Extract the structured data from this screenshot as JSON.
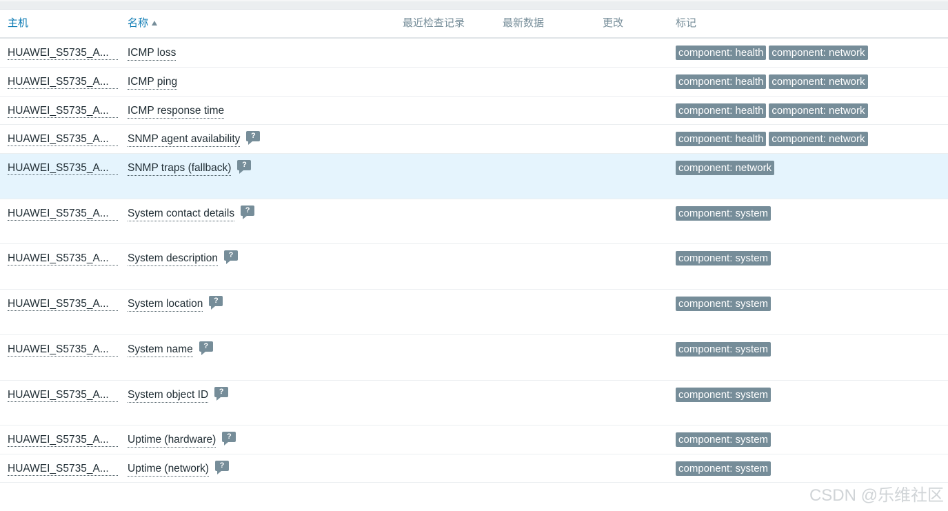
{
  "table": {
    "columns": {
      "host": "主机",
      "name": "名称",
      "last_check": "最近检查记录",
      "latest_data": "最新数据",
      "change": "更改",
      "tags": "标记"
    },
    "rows": [
      {
        "host": "HUAWEI_S5735_A...",
        "name": "ICMP loss",
        "help": "",
        "tags": [
          "component: health",
          "component: network"
        ]
      },
      {
        "host": "HUAWEI_S5735_A...",
        "name": "ICMP ping",
        "help": "",
        "tags": [
          "component: health",
          "component: network"
        ]
      },
      {
        "host": "HUAWEI_S5735_A...",
        "name": "ICMP response time",
        "help": "",
        "tags": [
          "component: health",
          "component: network"
        ]
      },
      {
        "host": "HUAWEI_S5735_A...",
        "name": "SNMP agent availability",
        "help": "?",
        "tags": [
          "component: health",
          "component: network"
        ]
      },
      {
        "host": "HUAWEI_S5735_A...",
        "name": "SNMP traps (fallback)",
        "help": "?",
        "tags": [
          "component: network"
        ]
      },
      {
        "host": "HUAWEI_S5735_A...",
        "name": "System contact details",
        "help": "?",
        "tags": [
          "component: system"
        ]
      },
      {
        "host": "HUAWEI_S5735_A...",
        "name": "System description",
        "help": "?",
        "tags": [
          "component: system"
        ]
      },
      {
        "host": "HUAWEI_S5735_A...",
        "name": "System location",
        "help": "?",
        "tags": [
          "component: system"
        ]
      },
      {
        "host": "HUAWEI_S5735_A...",
        "name": "System name",
        "help": "?",
        "tags": [
          "component: system"
        ]
      },
      {
        "host": "HUAWEI_S5735_A...",
        "name": "System object ID",
        "help": "?",
        "tags": [
          "component: system"
        ]
      },
      {
        "host": "HUAWEI_S5735_A...",
        "name": "Uptime (hardware)",
        "help": "?",
        "tags": [
          "component: system"
        ]
      },
      {
        "host": "HUAWEI_S5735_A...",
        "name": "Uptime (network)",
        "help": "?",
        "tags": [
          "component: system"
        ]
      }
    ]
  },
  "watermark": "CSDN @乐维社区",
  "colors": {
    "link": "#0a79b3",
    "tag_bg": "#768d99",
    "highlight_row": "#e5f4fd"
  }
}
